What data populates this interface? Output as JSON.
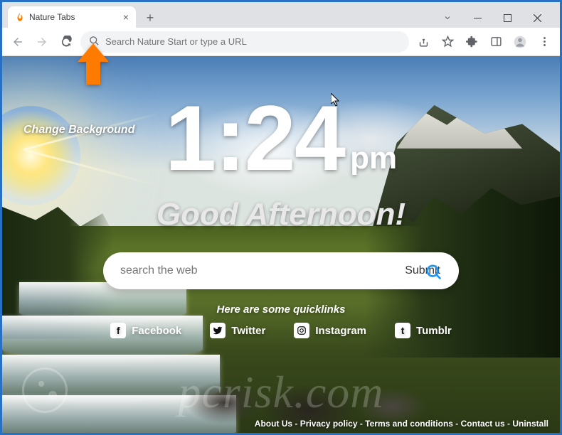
{
  "tab": {
    "title": "Nature Tabs"
  },
  "omnibox": {
    "placeholder": "Search Nature Start or type a URL"
  },
  "page": {
    "change_bg": "Change Background",
    "clock": {
      "time": "1:24",
      "ampm": "pm"
    },
    "greeting": "Good Afternoon!",
    "search": {
      "placeholder": "search the web",
      "submit": "Submit"
    },
    "quicklinks_header": "Here are some quicklinks",
    "quicklinks": [
      {
        "label": "Facebook",
        "glyph": "f"
      },
      {
        "label": "Twitter",
        "glyph": "t"
      },
      {
        "label": "Instagram",
        "glyph": "ig"
      },
      {
        "label": "Tumblr",
        "glyph": "t"
      }
    ],
    "footer": {
      "about": "About Us",
      "privacy": "Privacy policy",
      "terms": "Terms and conditions",
      "contact": "Contact us",
      "uninstall": "Uninstall",
      "sep": " - "
    }
  },
  "watermark": "pcrisk.com"
}
